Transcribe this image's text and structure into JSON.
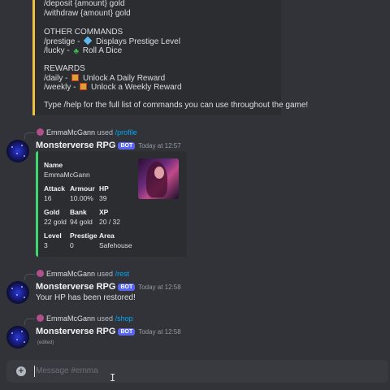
{
  "help_embed": {
    "lines": [
      "/deposit {amount} gold",
      "/withdraw {amount} gold",
      "",
      "OTHER COMMANDS",
      "/prestige - ",
      "/lucky - ",
      "",
      "REWARDS",
      "/daily - ",
      "/weekly - ",
      "",
      "Type /help for the full list of commands you can use throughout the game!"
    ],
    "prestige_text": "Displays Prestige Level",
    "lucky_text": "Roll A Dice",
    "daily_text": "Unlock A Daily Reward",
    "weekly_text": "Unlock a Weekly Reward",
    "accent_color": "#f0c040"
  },
  "messages": [
    {
      "reply_user": "EmmaMcGann",
      "reply_used": "used",
      "reply_command": "/profile",
      "author": "Monsterverse RPG",
      "bot_tag": "BOT",
      "timestamp": "Today at 12:57"
    },
    {
      "reply_user": "EmmaMcGann",
      "reply_used": "used",
      "reply_command": "/rest",
      "author": "Monsterverse RPG",
      "bot_tag": "BOT",
      "timestamp": "Today at 12:58",
      "text": "Your HP has been restored!"
    },
    {
      "reply_user": "EmmaMcGann",
      "reply_used": "used",
      "reply_command": "/shop",
      "author": "Monsterverse RPG",
      "bot_tag": "BOT",
      "timestamp": "Today at 12:58",
      "edited": "(edited)"
    }
  ],
  "profile": {
    "name_label": "Name",
    "name_value": "EmmaMcGann",
    "attack_label": "Attack",
    "attack_value": "16",
    "armour_label": "Armour",
    "armour_value": "10.00%",
    "hp_label": "HP",
    "hp_value": "39",
    "gold_label": "Gold",
    "gold_value": "22 gold",
    "bank_label": "Bank",
    "bank_value": "94 gold",
    "xp_label": "XP",
    "xp_value": "20 / 32",
    "level_label": "Level",
    "level_value": "3",
    "prestige_label": "Prestige",
    "prestige_value": "0",
    "area_label": "Area",
    "area_value": "Safehouse",
    "accent_color": "#3fda6f"
  },
  "composer": {
    "plus_icon": "+",
    "placeholder": "Message #emma",
    "cursor_glyph": "I"
  }
}
